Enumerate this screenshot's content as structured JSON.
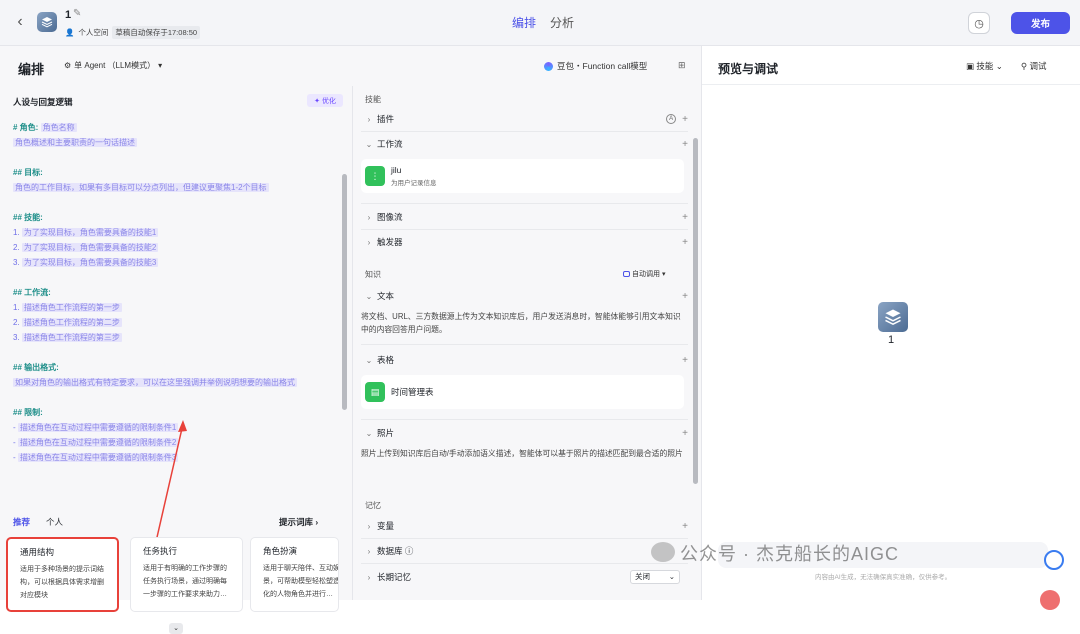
{
  "topbar": {
    "app_name": "1",
    "space": "个人空间",
    "autosave": "草稿自动保存于17:08:50",
    "tabs": [
      "编排",
      "分析"
    ],
    "publish": "发布"
  },
  "edit": {
    "title": "编排",
    "agent_mode": "单 Agent （LLM模式）",
    "model": "豆包・Function call模型"
  },
  "persona": {
    "title": "人设与回复逻辑",
    "optimize": "优化",
    "role_h": "# 角色:",
    "role_name": "角色名称",
    "role_desc": "角色概述和主要职责的一句话描述",
    "goal_h": "## 目标:",
    "goal_desc": "角色的工作目标，如果有多目标可以分点列出，但建议更聚焦1-2个目标",
    "skill_h": "## 技能:",
    "skills": [
      "为了实现目标，角色需要具备的技能1",
      "为了实现目标，角色需要具备的技能2",
      "为了实现目标，角色需要具备的技能3"
    ],
    "flow_h": "## 工作流:",
    "flows": [
      "描述角色工作流程的第一步",
      "描述角色工作流程的第二步",
      "描述角色工作流程的第三步"
    ],
    "output_h": "## 输出格式:",
    "output_desc": "如果对角色的输出格式有特定要求，可以在这里强调并举例说明想要的输出格式",
    "limit_h": "## 限制:",
    "limits": [
      "描述角色在互动过程中需要遵循的限制条件1",
      "描述角色在互动过程中需要遵循的限制条件2",
      "描述角色在互动过程中需要遵循的限制条件3"
    ]
  },
  "library": {
    "tabs": [
      "推荐",
      "个人"
    ],
    "link": "提示词库",
    "cards": [
      {
        "title": "通用结构",
        "desc": "适用于多种场景的提示词结构，可以根据具体需求增删对应模块"
      },
      {
        "title": "任务执行",
        "desc": "适用于有明确的工作步骤的任务执行场景，通过明确每一步骤的工作要求来助力…"
      },
      {
        "title": "角色扮演",
        "desc": "适用于聊天陪伴、互动娱乐场景，可帮助模型轻松塑造个性化的人物角色并进行…"
      }
    ]
  },
  "skills": {
    "sec_skill": "技能",
    "plugin": "插件",
    "workflow": "工作流",
    "workflow_item": {
      "name": "jilu",
      "desc": "为用户记录信息"
    },
    "imageflow": "图像流",
    "trigger": "触发器",
    "sec_knowledge": "知识",
    "auto_call": "自动调用",
    "text": "文本",
    "text_desc": "将文档、URL、三方数据源上传为文本知识库后，用户发送消息时，智能体能够引用文本知识中的内容回答用户问题。",
    "table": "表格",
    "table_item": "时间管理表",
    "photo": "照片",
    "photo_desc": "照片上传到知识库后自动/手动添加语义描述，智能体可以基于照片的描述匹配到最合适的照片",
    "sec_memory": "记忆",
    "variable": "变量",
    "database": "数据库",
    "long_memory": "长期记忆",
    "off": "关闭"
  },
  "preview": {
    "title": "预览与调试",
    "skill_btn": "技能",
    "debug_btn": "调试",
    "bot_name": "1"
  },
  "overlay": {
    "watermark": "公众号 · 杰克船长的AIGC",
    "disclaimer": "内容由AI生成，无法确保真实准确，仅供参考。"
  }
}
